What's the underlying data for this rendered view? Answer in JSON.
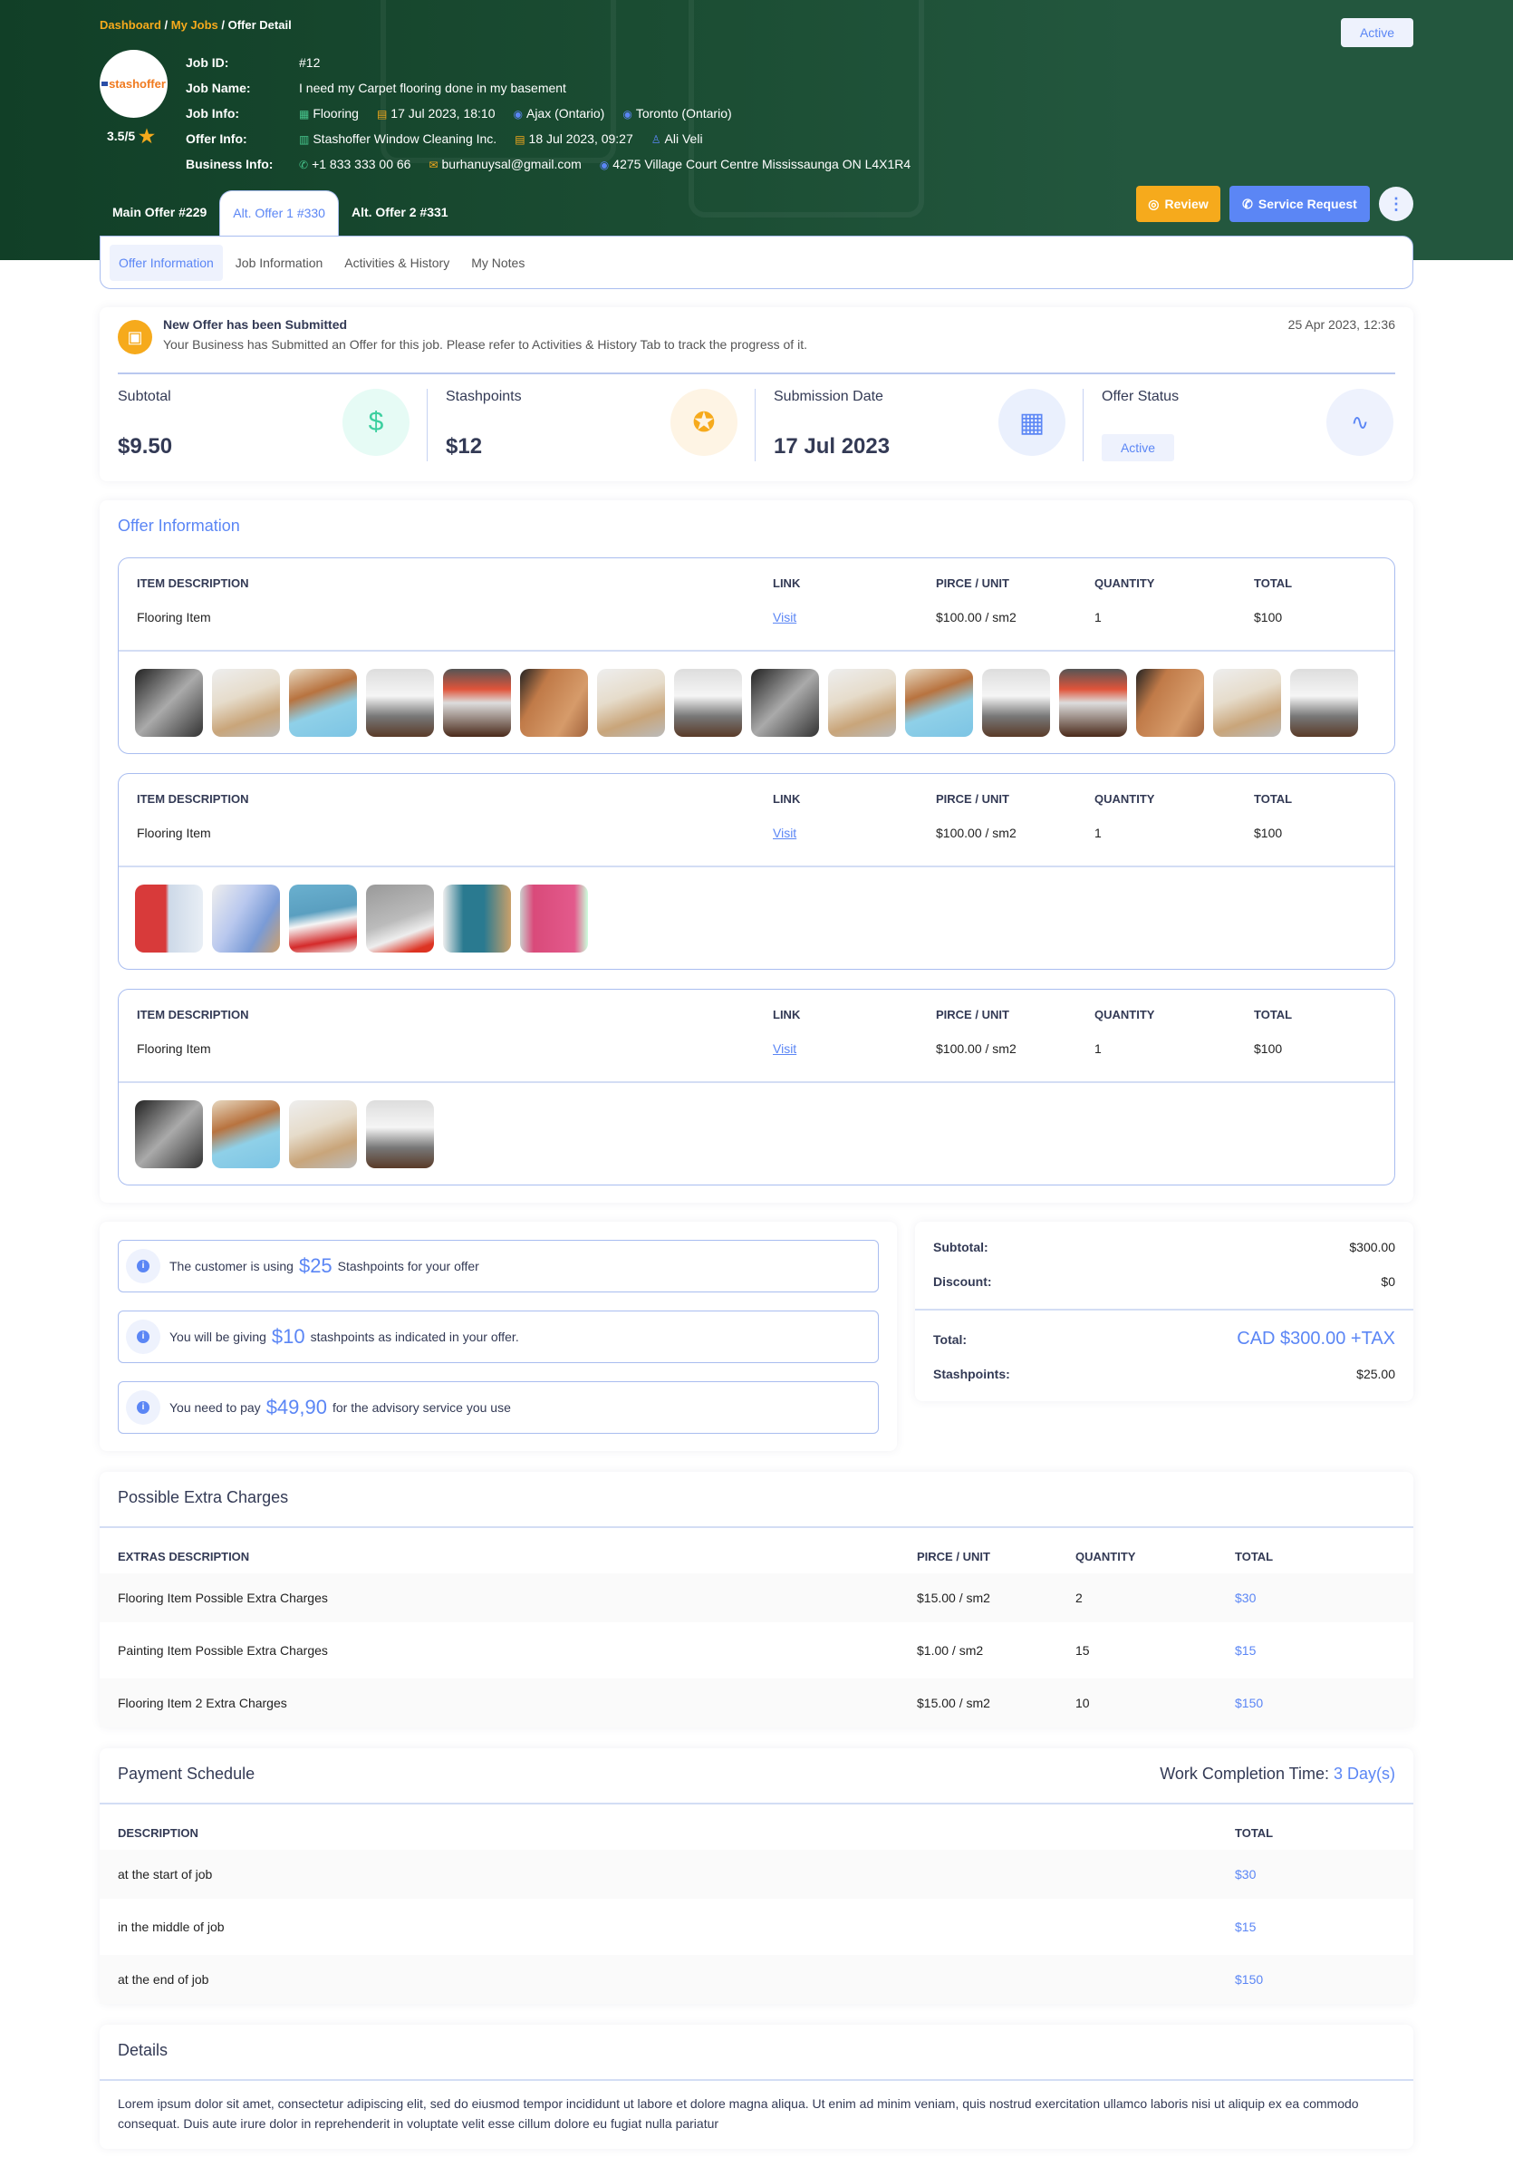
{
  "breadcrumb": {
    "items": [
      "Dashboard",
      "My Jobs"
    ],
    "current": "Offer Detail",
    "sep": " / "
  },
  "status_badge": "Active",
  "company": {
    "logo_text": "stashoffer",
    "rating": "3.5/5"
  },
  "job": {
    "labels": {
      "id": "Job ID:",
      "name": "Job Name:",
      "info": "Job Info:",
      "offer": "Offer Info:",
      "business": "Business Info:"
    },
    "id": "#12",
    "name": "I need my Carpet flooring done in my basement",
    "info": {
      "category": "Flooring",
      "date": "17 Jul 2023, 18:10",
      "from": "Ajax (Ontario)",
      "to": "Toronto (Ontario)"
    },
    "offer": {
      "company": "Stashoffer Window Cleaning Inc.",
      "date": "18 Jul 2023, 09:27",
      "person": "Ali Veli"
    },
    "business": {
      "phone": "+1 833 333 00 66",
      "email": "burhanuysal@gmail.com",
      "address": "4275 Village Court Centre Mississaunga ON L4X1R4"
    }
  },
  "offer_tabs": [
    {
      "label": "Main Offer #229"
    },
    {
      "label": "Alt. Offer 1 #330",
      "active": true
    },
    {
      "label": "Alt. Offer 2 #331"
    }
  ],
  "actions": {
    "review": "Review",
    "service_request": "Service Request"
  },
  "sub_tabs": [
    {
      "label": "Offer Information",
      "active": true
    },
    {
      "label": "Job Information"
    },
    {
      "label": "Activities & History"
    },
    {
      "label": "My Notes"
    }
  ],
  "notification": {
    "title": "New Offer has been Submitted",
    "text": "Your Business has Submitted an Offer for this job. Please refer to Activities & History Tab to track the progress of it.",
    "date": "25 Apr 2023, 12:36"
  },
  "stats": [
    {
      "label": "Subtotal",
      "value": "$9.50",
      "icon": "dollar-icon"
    },
    {
      "label": "Stashpoints",
      "value": "$12",
      "icon": "award-icon"
    },
    {
      "label": "Submission Date",
      "value": "17 Jul 2023",
      "icon": "calendar-icon"
    },
    {
      "label": "Offer Status",
      "value": "Active",
      "icon": "activity-icon"
    }
  ],
  "offer_info": {
    "title": "Offer Information",
    "headers": [
      "ITEM DESCRIPTION",
      "LINK",
      "PIRCE / UNIT",
      "QUANTITY",
      "TOTAL"
    ],
    "items": [
      {
        "description": "Flooring Item",
        "link": "Visit",
        "price": "$100.00 / sm2",
        "quantity": "1",
        "total": "$100",
        "photos": [
          "bw-room",
          "light-floor",
          "blue-underlay",
          "kitchen",
          "living-room",
          "wood-plank",
          "light-floor",
          "kitchen",
          "bw-room",
          "light-floor",
          "blue-underlay",
          "kitchen",
          "living-room",
          "wood-plank",
          "light-floor",
          "kitchen"
        ]
      },
      {
        "description": "Flooring Item",
        "link": "Visit",
        "price": "$100.00 / sm2",
        "quantity": "1",
        "total": "$100",
        "photos": [
          "red-paint",
          "blue-paint",
          "blue-roller",
          "grey-roller",
          "teal-paint",
          "pink-wall"
        ]
      },
      {
        "description": "Flooring Item",
        "link": "Visit",
        "price": "$100.00 / sm2",
        "quantity": "1",
        "total": "$100",
        "photos": [
          "bw-room",
          "blue-underlay",
          "light-floor",
          "kitchen"
        ]
      }
    ]
  },
  "notes": [
    {
      "pre": "The customer is using",
      "amount": "$25",
      "post": "Stashpoints for your offer"
    },
    {
      "pre": "You will be giving",
      "amount": "$10",
      "post": "stashpoints as indicated in your offer."
    },
    {
      "pre": "You need to pay",
      "amount": "$49,90",
      "post": "for the advisory service you use"
    }
  ],
  "summary": {
    "subtotal_label": "Subtotal:",
    "subtotal": "$300.00",
    "discount_label": "Discount:",
    "discount": "$0",
    "total_label": "Total:",
    "total": "CAD $300.00 +TAX",
    "stashpoints_label": "Stashpoints:",
    "stashpoints": "$25.00"
  },
  "extras": {
    "title": "Possible Extra Charges",
    "headers": [
      "EXTRAS DESCRIPTION",
      "PIRCE / UNIT",
      "QUANTITY",
      "TOTAL"
    ],
    "rows": [
      {
        "description": "Flooring Item Possible Extra Charges",
        "price": "$15.00 / sm2",
        "quantity": "2",
        "total": "$30"
      },
      {
        "description": "Painting Item Possible Extra Charges",
        "price": "$1.00 / sm2",
        "quantity": "15",
        "total": "$15"
      },
      {
        "description": "Flooring Item 2 Extra Charges",
        "price": "$15.00 / sm2",
        "quantity": "10",
        "total": "$150"
      }
    ]
  },
  "payment": {
    "title": "Payment Schedule",
    "completion_label": "Work Completion Time:",
    "completion_value": "3 Day(s)",
    "headers": [
      "DESCRIPTION",
      "TOTAL"
    ],
    "rows": [
      {
        "description": "at the start of job",
        "total": "$30"
      },
      {
        "description": "in the middle of job",
        "total": "$15"
      },
      {
        "description": "at the end of job",
        "total": "$150"
      }
    ]
  },
  "details": {
    "title": "Details",
    "text": "Lorem ipsum dolor sit amet, consectetur adipiscing elit, sed do eiusmod tempor incididunt ut labore et dolore magna aliqua. Ut enim ad minim veniam, quis nostrud exercitation ullamco laboris nisi ut aliquip ex ea commodo consequat. Duis aute irure dolor  in reprehenderit in voluptate velit esse cillum dolore eu fugiat nulla pariatur"
  },
  "colors": {
    "header_green": "#23573e",
    "accent_blue": "#5b86f5",
    "accent_orange": "#f6aa1c"
  }
}
